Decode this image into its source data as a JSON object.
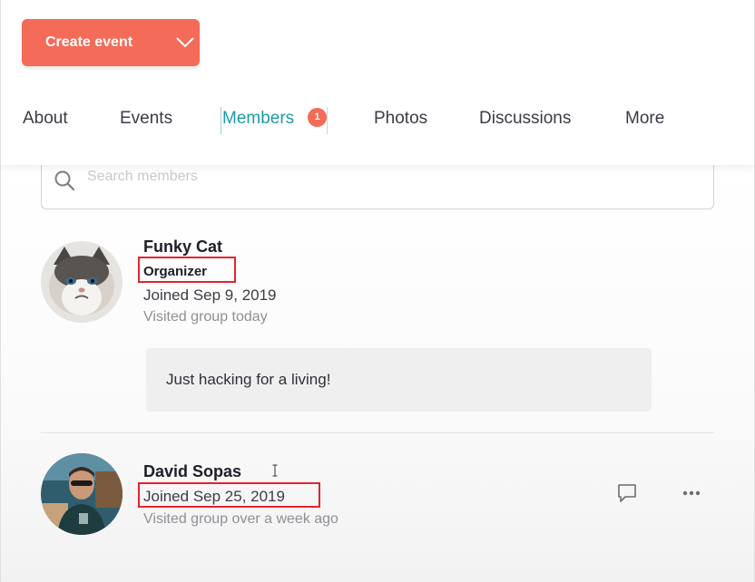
{
  "header": {
    "create_event_label": "Create event",
    "tabs": [
      {
        "label": "About"
      },
      {
        "label": "Events"
      },
      {
        "label": "Members",
        "badge": "1",
        "active": true
      },
      {
        "label": "Photos"
      },
      {
        "label": "Discussions"
      },
      {
        "label": "More"
      }
    ]
  },
  "search": {
    "placeholder": "Search members"
  },
  "members": [
    {
      "name": "Funky Cat",
      "role": "Organizer",
      "joined": "Joined Sep 9, 2019",
      "visited": "Visited group today",
      "bio": "Just hacking for a living!",
      "avatar": "grumpy-cat-avatar"
    },
    {
      "name": "David Sopas",
      "joined": "Joined Sep 25, 2019",
      "visited": "Visited group over a week ago",
      "avatar": "person-sunglasses-avatar",
      "actions": [
        "message-icon",
        "more-dots-icon"
      ]
    }
  ],
  "colors": {
    "accent": "#f46b58",
    "active_tab": "#1f9aa6",
    "highlight_box": "#e3232f"
  }
}
